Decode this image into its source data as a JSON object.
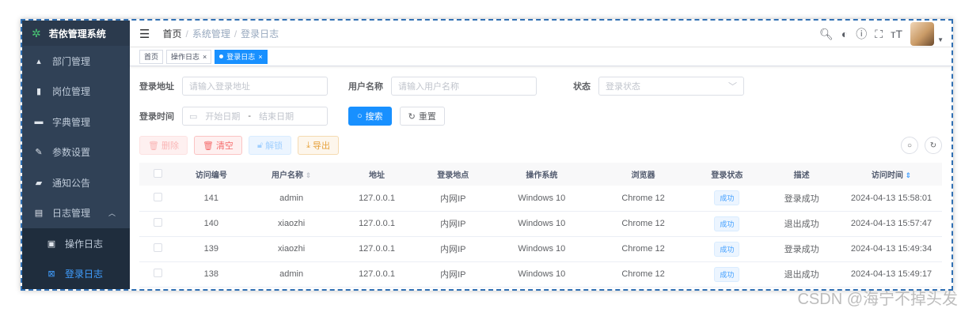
{
  "app": {
    "title": "若依管理系统"
  },
  "sidebar": {
    "items": [
      {
        "label": "部门管理",
        "icon": "tree-icon"
      },
      {
        "label": "岗位管理",
        "icon": "post-icon"
      },
      {
        "label": "字典管理",
        "icon": "dict-icon"
      },
      {
        "label": "参数设置",
        "icon": "edit-icon"
      },
      {
        "label": "通知公告",
        "icon": "message-icon"
      },
      {
        "label": "日志管理",
        "icon": "log-icon"
      },
      {
        "label": "操作日志",
        "icon": "form-icon"
      },
      {
        "label": "登录日志",
        "icon": "logininfor-icon"
      }
    ]
  },
  "breadcrumb": {
    "home": "首页",
    "level1": "系统管理",
    "level2": "登录日志"
  },
  "tags": {
    "home": "首页",
    "oper": "操作日志",
    "login": "登录日志"
  },
  "search": {
    "ipaddr_label": "登录地址",
    "ipaddr_placeholder": "请输入登录地址",
    "username_label": "用户名称",
    "username_placeholder": "请输入用户名称",
    "status_label": "状态",
    "status_placeholder": "登录状态",
    "time_label": "登录时间",
    "start_placeholder": "开始日期",
    "range_sep": "-",
    "end_placeholder": "结束日期",
    "search_btn": "搜索",
    "reset_btn": "重置"
  },
  "toolbar": {
    "delete": "删除",
    "clear": "清空",
    "unlock": "解锁",
    "export": "导出"
  },
  "table": {
    "headers": [
      "访问编号",
      "用户名称",
      "地址",
      "登录地点",
      "操作系统",
      "浏览器",
      "登录状态",
      "描述",
      "访问时间"
    ],
    "rows": [
      [
        "141",
        "admin",
        "127.0.0.1",
        "内网IP",
        "Windows 10",
        "Chrome 12",
        "成功",
        "登录成功",
        "2024-04-13 15:58:01"
      ],
      [
        "140",
        "xiaozhi",
        "127.0.0.1",
        "内网IP",
        "Windows 10",
        "Chrome 12",
        "成功",
        "退出成功",
        "2024-04-13 15:57:47"
      ],
      [
        "139",
        "xiaozhi",
        "127.0.0.1",
        "内网IP",
        "Windows 10",
        "Chrome 12",
        "成功",
        "登录成功",
        "2024-04-13 15:49:34"
      ],
      [
        "138",
        "admin",
        "127.0.0.1",
        "内网IP",
        "Windows 10",
        "Chrome 12",
        "成功",
        "退出成功",
        "2024-04-13 15:49:17"
      ]
    ]
  },
  "watermark": "CSDN @海宁不掉头发",
  "colors": {
    "sidebar": "#304156",
    "primary": "#1890ff"
  }
}
